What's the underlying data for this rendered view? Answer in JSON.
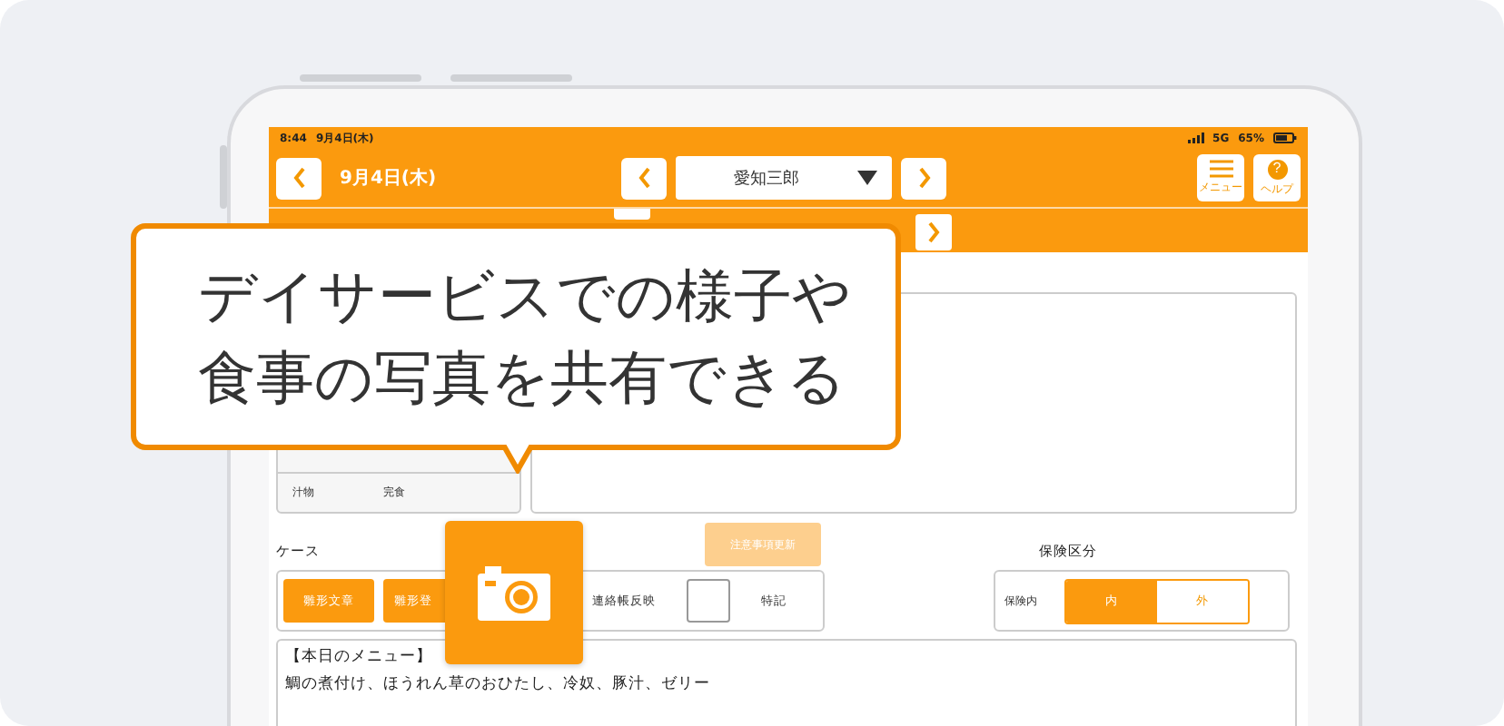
{
  "status_bar": {
    "time": "8:44",
    "date": "9月4日(木)",
    "network": "5G",
    "battery": "65%"
  },
  "nav": {
    "date": "9月4日(木)",
    "person": "愛知三郎",
    "menu_label": "メニュー",
    "help_label": "ヘルプ",
    "help_glyph": "?"
  },
  "meal_rows": [
    {
      "item": "汁物",
      "result": "完食"
    }
  ],
  "notice_button": {
    "label": "注意事項更新",
    "disabled": true
  },
  "case": {
    "title": "ケース",
    "buttons": [
      "雛形文章",
      "雛形登"
    ],
    "reflect_label": "連絡帳反映",
    "checkbox": {
      "label": "特記",
      "checked": false
    }
  },
  "insurance": {
    "title": "保険区分",
    "label": "保険内",
    "options": [
      {
        "label": "内",
        "selected": true
      },
      {
        "label": "外",
        "selected": false
      }
    ]
  },
  "note": {
    "lines": [
      "【本日のメニュー】",
      "鯛の煮付け、ほうれん草のおひたし、冷奴、豚汁、ゼリー"
    ]
  },
  "callout": {
    "lines": [
      "デイサービスでの様子や",
      "食事の写真を共有できる"
    ]
  }
}
